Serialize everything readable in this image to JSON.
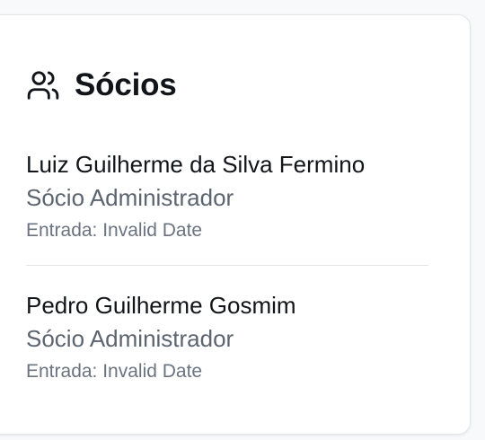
{
  "card": {
    "title": "Sócios",
    "icon": "users-icon"
  },
  "partners": [
    {
      "name": "Luiz Guilherme da Silva Fermino",
      "role": "Sócio Administrador",
      "entry": "Entrada: Invalid Date"
    },
    {
      "name": "Pedro Guilherme Gosmim",
      "role": "Sócio Administrador",
      "entry": "Entrada: Invalid Date"
    }
  ]
}
